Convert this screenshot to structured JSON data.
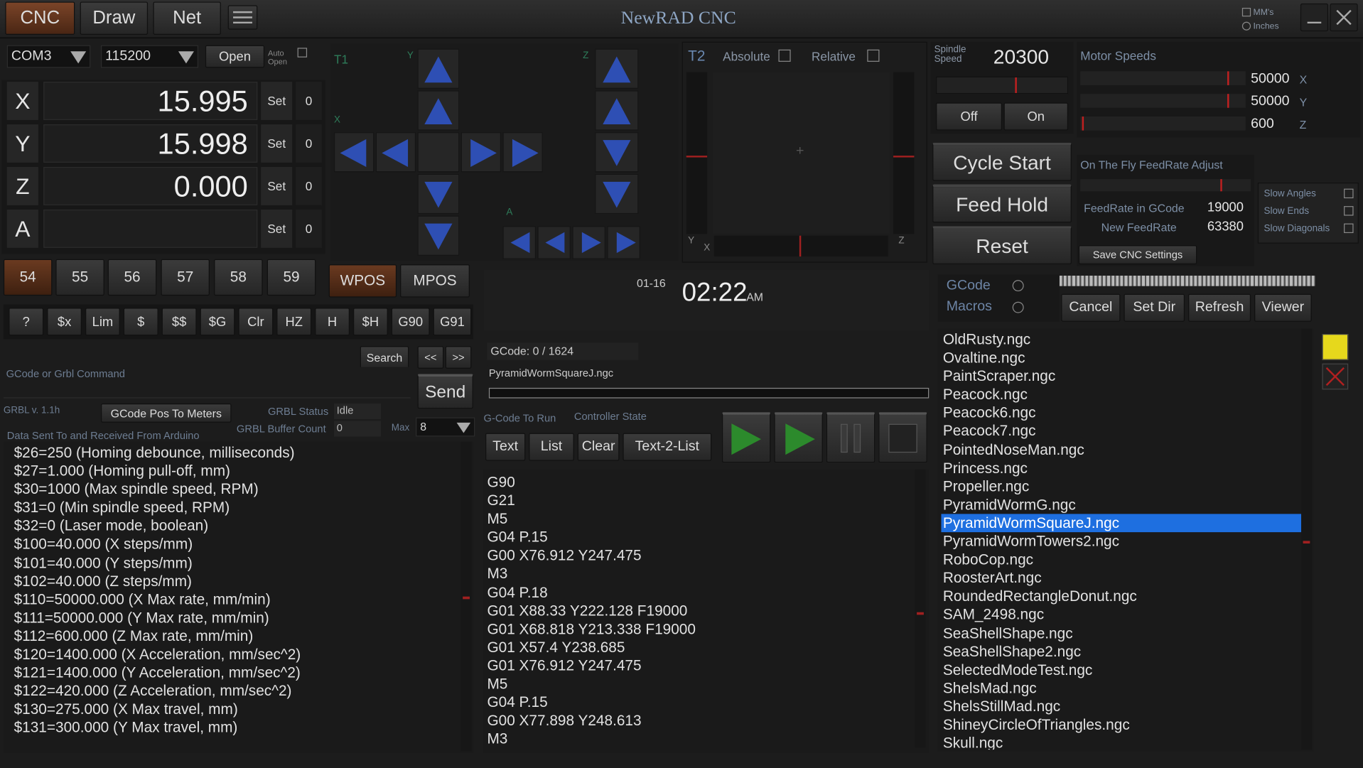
{
  "app": {
    "title": "NewRAD CNC",
    "tabs": [
      "CNC",
      "Draw",
      "Net"
    ]
  },
  "units": {
    "mms": "MM's",
    "inches": "Inches"
  },
  "connection": {
    "port": "COM3",
    "baud": "115200",
    "open": "Open",
    "auto_open": "Auto Open"
  },
  "axes": [
    {
      "label": "X",
      "value": "15.995",
      "set": "Set",
      "zero": "0"
    },
    {
      "label": "Y",
      "value": "15.998",
      "set": "Set",
      "zero": "0"
    },
    {
      "label": "Z",
      "value": "0.000",
      "set": "Set",
      "zero": "0"
    },
    {
      "label": "A",
      "value": "",
      "set": "Set",
      "zero": "0"
    }
  ],
  "wcs": [
    "54",
    "55",
    "56",
    "57",
    "58",
    "59"
  ],
  "wpos": "WPOS",
  "mpos": "MPOS",
  "commands": [
    "?",
    "$x",
    "Lim",
    "$",
    "$$",
    "$G",
    "Clr",
    "HZ",
    "H",
    "$H",
    "G90",
    "G91"
  ],
  "jog": {
    "t1": "T1",
    "y": "Y",
    "x": "X",
    "z": "Z",
    "a": "A"
  },
  "plot": {
    "t2": "T2",
    "absolute": "Absolute",
    "relative": "Relative",
    "y": "Y",
    "x": "X",
    "z": "Z"
  },
  "spindle": {
    "label": "Spindle Speed",
    "value": "20300",
    "off": "Off",
    "on": "On",
    "level": 0.6
  },
  "motors": {
    "title": "Motor Speeds",
    "x": "50000",
    "y": "50000",
    "z": "600",
    "xl": "X",
    "yl": "Y",
    "zl": "Z",
    "x_level": 0.9,
    "y_level": 0.9,
    "z_level": 0.01
  },
  "controls": {
    "cycle_start": "Cycle Start",
    "feed_hold": "Feed Hold",
    "reset": "Reset"
  },
  "feed": {
    "title": "On The Fly FeedRate Adjust",
    "gcode_label": "FeedRate in GCode",
    "gcode_value": "19000",
    "new_label": "New FeedRate",
    "new_value": "63380",
    "save": "Save CNC Settings",
    "level": 0.83
  },
  "slow": {
    "angles": "Slow Angles",
    "ends": "Slow Ends",
    "diagonals": "Slow Diagonals"
  },
  "clock": {
    "date": "01-16",
    "time": "02:22",
    "ampm": "AM"
  },
  "command": {
    "search": "Search",
    "prev": "<<",
    "next": ">>",
    "placeholder": "GCode or Grbl Command",
    "send": "Send"
  },
  "status": {
    "grbl_version": "GRBL v. 1.1h",
    "pos_to_meters": "GCode Pos To Meters",
    "grbl_status_label": "GRBL Status",
    "grbl_status": "Idle",
    "buffer_label": "GRBL Buffer Count",
    "buffer": "0",
    "max_label": "Max",
    "max": "8",
    "data_label": "Data Sent To and Received From Arduino"
  },
  "console": [
    "$26=250 (Homing debounce, milliseconds)",
    "$27=1.000 (Homing pull-off, mm)",
    "$30=1000 (Max spindle speed, RPM)",
    "$31=0 (Min spindle speed, RPM)",
    "$32=0 (Laser mode, boolean)",
    "$100=40.000 (X steps/mm)",
    "$101=40.000 (Y steps/mm)",
    "$102=40.000 (Z steps/mm)",
    "$110=50000.000 (X Max rate, mm/min)",
    "$111=50000.000 (Y Max rate, mm/min)",
    "$112=600.000 (Z Max rate, mm/min)",
    "$120=1400.000 (X Acceleration, mm/sec^2)",
    "$121=1400.000 (Y Acceleration, mm/sec^2)",
    "$122=420.000 (Z Acceleration, mm/sec^2)",
    "$130=275.000 (X Max travel, mm)",
    "$131=300.000 (Y Max travel, mm)"
  ],
  "gcode": {
    "progress": "GCode: 0 / 1624",
    "file": "PyramidWormSquareJ.ngc",
    "to_run": "G-Code To Run",
    "controller_state": "Controller State",
    "text": "Text",
    "list": "List",
    "clear": "Clear",
    "text2list": "Text-2-List",
    "lines": [
      "G90",
      "G21",
      "M5",
      "G04 P.15",
      "G00 X76.912 Y247.475",
      "M3",
      "G04 P.18",
      "G01 X88.33 Y222.128 F19000",
      "G01 X68.818 Y213.338 F19000",
      "G01 X57.4 Y238.685",
      "G01 X76.912 Y247.475",
      "M5",
      "G04 P.15",
      "G00 X77.898 Y248.613",
      "M3"
    ]
  },
  "files": {
    "gcode": "GCode",
    "macros": "Macros",
    "cancel": "Cancel",
    "set_dir": "Set Dir",
    "refresh": "Refresh",
    "viewer": "Viewer",
    "selected": "PyramidWormSquareJ.ngc",
    "items": [
      "OldRusty.ngc",
      "Ovaltine.ngc",
      "PaintScraper.ngc",
      "Peacock.ngc",
      "Peacock6.ngc",
      "Peacock7.ngc",
      "PointedNoseMan.ngc",
      "Princess.ngc",
      "Propeller.ngc",
      "PyramidWormG.ngc",
      "PyramidWormSquareJ.ngc",
      "PyramidWormTowers2.ngc",
      "RoboCop.ngc",
      "RoosterArt.ngc",
      "RoundedRectangleDonut.ngc",
      "SAM_2498.ngc",
      "SeaShellShape.ngc",
      "SeaShellShape2.ngc",
      "SelectedModeTest.ngc",
      "ShelsMad.ngc",
      "ShelsStillMad.ngc",
      "ShineyCircleOfTriangles.ngc",
      "Skull.ngc"
    ]
  },
  "colors": {
    "accent": "#2e4fb4",
    "selected": "#1e6fe0",
    "play": "#2c8a2c",
    "tab_active": "#6a3a20"
  }
}
